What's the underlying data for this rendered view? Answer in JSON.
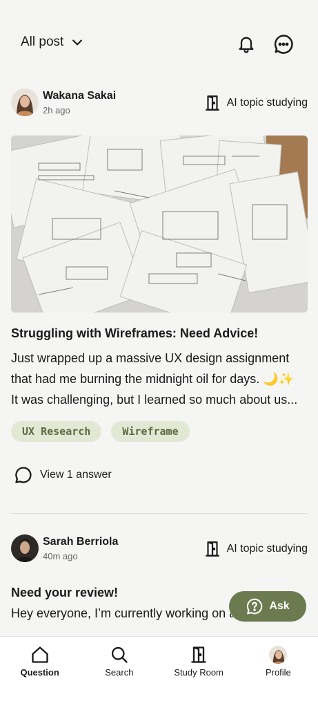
{
  "header": {
    "filter_label": "All post"
  },
  "posts": [
    {
      "author": "Wakana Sakai",
      "time": "2h ago",
      "room": "AI topic studying",
      "title": "Struggling with Wireframes: Need Advice!",
      "body_lines": [
        "Just wrapped up a massive UX design assignment",
        "that had me burning the midnight oil for days. 🌙✨",
        "It was challenging, but I learned so much about us..."
      ],
      "tags": [
        "UX Research",
        "Wireframe"
      ],
      "answers_label": "View 1 answer"
    },
    {
      "author": "Sarah Berriola",
      "time": "40m ago",
      "room": "AI topic studying",
      "title": "Need your review!",
      "body_lines": [
        "Hey everyone, I’m currently working on a school"
      ]
    }
  ],
  "ask_button": {
    "label": "Ask"
  },
  "nav": [
    {
      "label": "Question",
      "icon": "home-icon",
      "active": true
    },
    {
      "label": "Search",
      "icon": "search-icon"
    },
    {
      "label": "Study Room",
      "icon": "door-icon"
    },
    {
      "label": "Profile",
      "icon": "avatar"
    }
  ],
  "colors": {
    "accent": "#6b7a4f",
    "tag_bg": "#e3e8d4",
    "tag_text": "#5b6a43",
    "background": "#f5f5f4"
  }
}
